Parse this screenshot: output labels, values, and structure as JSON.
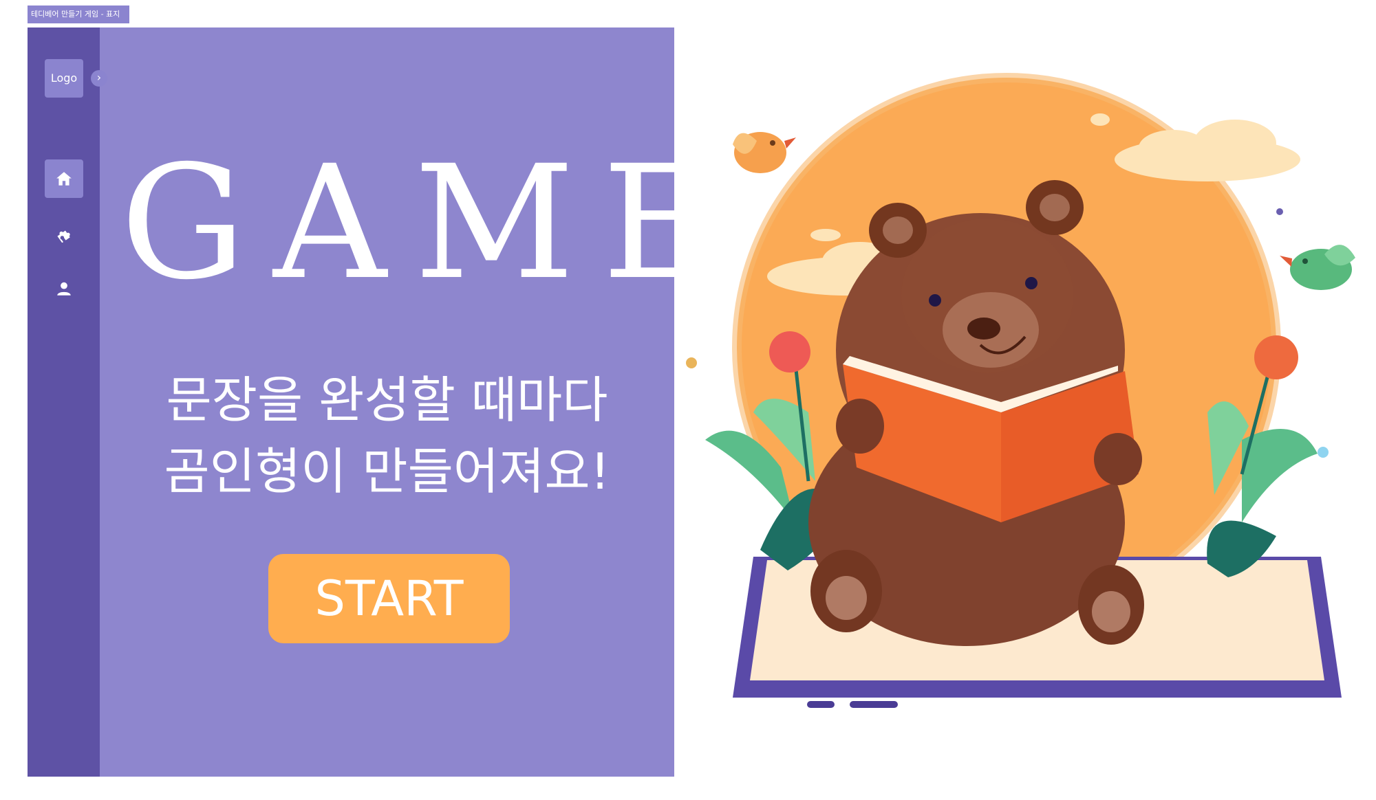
{
  "frame": {
    "label": "테디베어 만들기 게임 - 표지"
  },
  "sidebar": {
    "logo_label": "Logo",
    "collapse_icon": "chevron-right-icon",
    "items": [
      {
        "icon": "home-icon",
        "active": true
      },
      {
        "icon": "puzzle-icon",
        "active": false
      },
      {
        "icon": "user-icon",
        "active": false
      }
    ]
  },
  "main": {
    "title": "GAME",
    "subtitle_line1": "문장을 완성할 때마다",
    "subtitle_line2": "곰인형이 만들어져요!",
    "start_label": "START"
  },
  "colors": {
    "sidebar": "#5e52a5",
    "panel": "#8e86ce",
    "accent": "#ffad4f",
    "text": "#ffffff"
  }
}
